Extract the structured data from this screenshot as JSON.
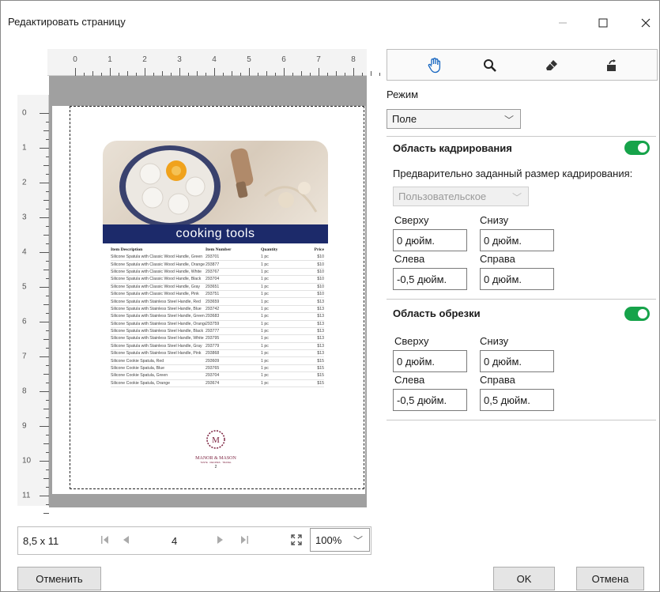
{
  "window": {
    "title": "Редактировать страницу",
    "min_icon": "minimize-icon",
    "max_icon": "maximize-icon",
    "close_icon": "close-icon"
  },
  "ruler": {
    "h_labels": [
      "0",
      "1",
      "2",
      "3",
      "4",
      "5",
      "6",
      "7",
      "8"
    ],
    "v_labels": [
      "0",
      "1",
      "2",
      "3",
      "4",
      "5",
      "6",
      "7",
      "8",
      "9",
      "10",
      "11"
    ]
  },
  "document": {
    "banner": "cooking tools",
    "table_headers": [
      "Item Description",
      "Item Number",
      "Quantity",
      "Price"
    ],
    "rows": [
      [
        "Silicone Spatula with Classic Wood Handle, Green",
        "293701",
        "1 pc",
        "$10"
      ],
      [
        "Silicone Spatula with Classic Wood Handle, Orange",
        "293877",
        "1 pc",
        "$10"
      ],
      [
        "Silicone Spatula with Classic Wood Handle, White",
        "293767",
        "1 pc",
        "$10"
      ],
      [
        "Silicone Spatula with Classic Wood Handle, Black",
        "293704",
        "1 pc",
        "$10"
      ],
      [
        "Silicone Spatula with Classic Wood Handle, Gray",
        "293651",
        "1 pc",
        "$10"
      ],
      [
        "Silicone Spatula with Classic Wood Handle, Pink",
        "293751",
        "1 pc",
        "$10"
      ],
      [
        "Silicone Spatula with Stainless Steel Handle, Red",
        "293659",
        "1 pc",
        "$13"
      ],
      [
        "Silicone Spatula with Stainless Steel Handle, Blue",
        "293742",
        "1 pc",
        "$13"
      ],
      [
        "Silicone Spatula with Stainless Steel Handle, Green",
        "293683",
        "1 pc",
        "$13"
      ],
      [
        "Silicone Spatula with Stainless Steel Handle, Orange",
        "293759",
        "1 pc",
        "$13"
      ],
      [
        "Silicone Spatula with Stainless Steel Handle, Black",
        "293777",
        "1 pc",
        "$13"
      ],
      [
        "Silicone Spatula with Stainless Steel Handle, White",
        "293795",
        "1 pc",
        "$13"
      ],
      [
        "Silicone Spatula with Stainless Steel Handle, Gray",
        "293779",
        "1 pc",
        "$13"
      ],
      [
        "Silicone Spatula with Stainless Steel Handle, Pink",
        "293868",
        "1 pc",
        "$13"
      ],
      [
        "Silicone Cookie Spatula, Red",
        "293609",
        "1 pc",
        "$15"
      ],
      [
        "Silicone Cookie Spatula, Blue",
        "293765",
        "1 pc",
        "$15"
      ],
      [
        "Silicone Cookie Spatula, Green",
        "293704",
        "1 pc",
        "$15"
      ],
      [
        "Silicone Cookie Spatula, Orange",
        "293674",
        "1 pc",
        "$15"
      ]
    ],
    "logo_letter": "M",
    "logo_name": "MANOR & MASON",
    "logo_sub": "TASTE · RECIPES · TRAVEL",
    "page_number": "2"
  },
  "tools": {
    "hand": "hand-icon",
    "zoom": "magnifier-icon",
    "eraser": "eraser-icon",
    "rotate": "rotate-page-icon"
  },
  "panel": {
    "mode_label": "Режим",
    "mode_value": "Поле",
    "crop_title": "Область кадрирования",
    "preset_label": "Предварительно заданный размер кадрирования:",
    "preset_value": "Пользовательское",
    "crop_top_label": "Сверху",
    "crop_bottom_label": "Снизу",
    "crop_left_label": "Слева",
    "crop_right_label": "Справа",
    "crop_top": "0 дюйм.",
    "crop_bottom": "0 дюйм.",
    "crop_left": "-0,5 дюйм.",
    "crop_right": "0 дюйм.",
    "trim_title": "Область обрезки",
    "trim_top_label": "Сверху",
    "trim_bottom_label": "Снизу",
    "trim_left_label": "Слева",
    "trim_right_label": "Справа",
    "trim_top": "0 дюйм.",
    "trim_bottom": "0 дюйм.",
    "trim_left": "-0,5 дюйм.",
    "trim_right": "0,5 дюйм.",
    "toggle_color": "#16a34a"
  },
  "nav": {
    "page_size": "8,5 x 11",
    "page_number": "4",
    "zoom": "100%"
  },
  "buttons": {
    "reset": "Отменить",
    "ok": "OK",
    "cancel": "Отмена"
  }
}
